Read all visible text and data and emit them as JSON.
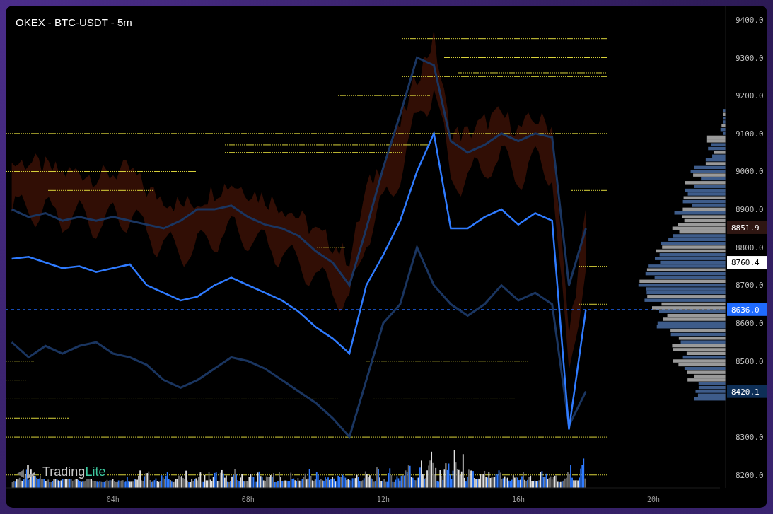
{
  "header": {
    "title": "OKEX - BTC-USDT - 5m"
  },
  "logo": {
    "text_1": "Trading",
    "text_2": "Lite"
  },
  "price_markers": [
    {
      "label": "8851.9",
      "color": "#2e1612",
      "kind": "level"
    },
    {
      "label": "8760.4",
      "color": "#ffffff",
      "kind": "level"
    },
    {
      "label": "8636.0",
      "color": "#1f6bff",
      "kind": "last"
    },
    {
      "label": "8420.1",
      "color": "#0e2f57",
      "kind": "level"
    }
  ],
  "chart_data": {
    "type": "line",
    "x": [
      1,
      1.5,
      2,
      2.5,
      3,
      3.5,
      4,
      4.5,
      5,
      5.5,
      6,
      6.5,
      7,
      7.5,
      8,
      8.5,
      9,
      9.5,
      10,
      10.5,
      11,
      11.5,
      12,
      12.5,
      13,
      13.5,
      14,
      14.5,
      15,
      15.5,
      16,
      16.5,
      17,
      17.5,
      18
    ],
    "series": [
      {
        "color": "#2f7bff",
        "values": [
          8770,
          8775,
          8760,
          8745,
          8750,
          8735,
          8745,
          8755,
          8700,
          8680,
          8660,
          8670,
          8700,
          8720,
          8700,
          8680,
          8660,
          8630,
          8590,
          8560,
          8520,
          8700,
          8780,
          8870,
          9000,
          9100,
          8850,
          8850,
          8880,
          8900,
          8860,
          8890,
          8870,
          8320,
          8636
        ]
      },
      {
        "color": "#1a3560",
        "values": [
          8900,
          8880,
          8890,
          8870,
          8880,
          8870,
          8880,
          8870,
          8860,
          8850,
          8870,
          8900,
          8900,
          8910,
          8880,
          8860,
          8850,
          8830,
          8790,
          8760,
          8700,
          8850,
          9010,
          9150,
          9300,
          9280,
          9080,
          9050,
          9070,
          9100,
          9080,
          9100,
          9090,
          8700,
          8850
        ]
      },
      {
        "color": "#1a3560",
        "values": [
          8550,
          8510,
          8540,
          8520,
          8540,
          8550,
          8520,
          8510,
          8490,
          8450,
          8430,
          8450,
          8480,
          8510,
          8500,
          8480,
          8450,
          8420,
          8390,
          8350,
          8300,
          8450,
          8600,
          8650,
          8800,
          8700,
          8650,
          8620,
          8650,
          8700,
          8660,
          8680,
          8650,
          8330,
          8420
        ]
      }
    ],
    "xticks": [
      {
        "value": 4,
        "label": "04h"
      },
      {
        "value": 8,
        "label": "08h"
      },
      {
        "value": 12,
        "label": "12h"
      },
      {
        "value": 16,
        "label": "16h"
      },
      {
        "value": 20,
        "label": "20h"
      }
    ],
    "yticks": [
      {
        "value": 8200,
        "label": "8200.0"
      },
      {
        "value": 8300,
        "label": "8300.0"
      },
      {
        "value": 8500,
        "label": "8500.0"
      },
      {
        "value": 8600,
        "label": "8600.0"
      },
      {
        "value": 8700,
        "label": "8700.0"
      },
      {
        "value": 8800,
        "label": "8800.0"
      },
      {
        "value": 8900,
        "label": "8900.0"
      },
      {
        "value": 9000,
        "label": "9000.0"
      },
      {
        "value": 9100,
        "label": "9100.0"
      },
      {
        "value": 9200,
        "label": "9200.0"
      },
      {
        "value": 9300,
        "label": "9300.0"
      },
      {
        "value": 9400,
        "label": "9400.0"
      }
    ],
    "xlim": [
      0.82,
      21.97
    ],
    "ylim": [
      8166,
      9437
    ]
  }
}
